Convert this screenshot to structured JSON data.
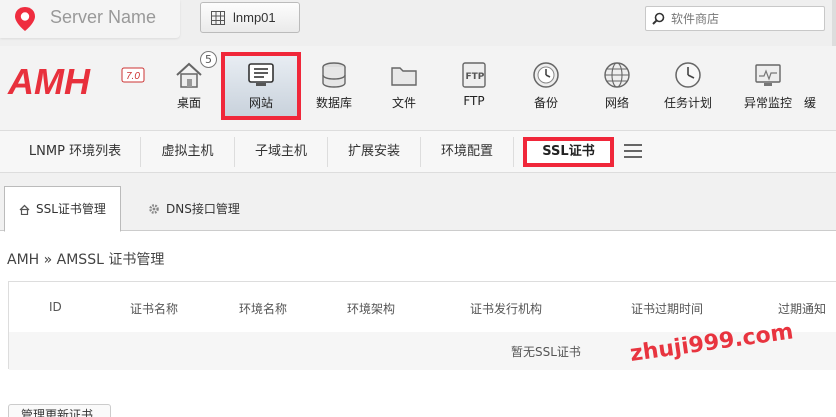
{
  "header": {
    "server_name": "Server Name",
    "env_button_label": "lnmp01",
    "search_placeholder": "软件商店"
  },
  "logo": {
    "text": "AMH",
    "version": "7.0"
  },
  "nav": {
    "desktop_badge": "5",
    "items": [
      {
        "label": "桌面",
        "icon": "home-icon"
      },
      {
        "label": "网站",
        "icon": "website-icon"
      },
      {
        "label": "数据库",
        "icon": "database-icon"
      },
      {
        "label": "文件",
        "icon": "folder-icon"
      },
      {
        "label": "FTP",
        "icon": "ftp-icon"
      },
      {
        "label": "备份",
        "icon": "backup-icon"
      },
      {
        "label": "网络",
        "icon": "globe-icon"
      },
      {
        "label": "任务计划",
        "icon": "clock-icon"
      },
      {
        "label": "异常监控",
        "icon": "monitor-icon"
      },
      {
        "label": "缓",
        "icon": "cache-icon"
      }
    ],
    "active": "网站"
  },
  "subtabs": [
    {
      "label": "LNMP 环境列表"
    },
    {
      "label": "虚拟主机"
    },
    {
      "label": "子域主机"
    },
    {
      "label": "扩展安装"
    },
    {
      "label": "环境配置"
    },
    {
      "label": "SSL证书"
    }
  ],
  "content_tabs": [
    {
      "label": "SSL证书管理",
      "icon": "home-icon"
    },
    {
      "label": "DNS接口管理",
      "icon": "gear-icon"
    }
  ],
  "breadcrumb": "AMH » AMSSL 证书管理",
  "table": {
    "columns": [
      "ID",
      "证书名称",
      "环境名称",
      "环境架构",
      "证书发行机构",
      "证书过期时间",
      "过期通知"
    ],
    "empty_text": "暂无SSL证书"
  },
  "renew_button": "管理更新证书",
  "watermark": "zhuji999.com",
  "colors": {
    "accent_red": "#f0273a",
    "watermark": "#e8343f"
  }
}
